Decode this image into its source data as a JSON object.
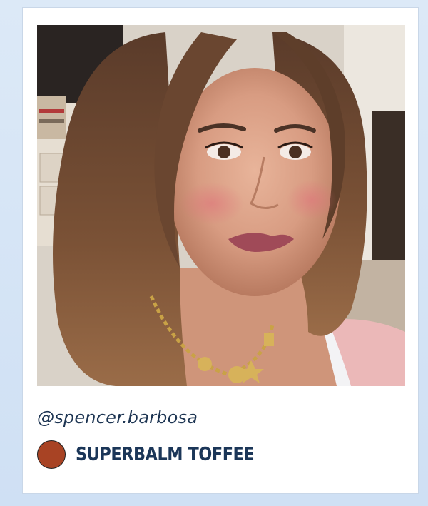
{
  "post": {
    "handle": "@spencer.barbosa",
    "product_name": "SUPERBALM TOFFEE",
    "swatch_color": "#a84324",
    "photo_alt": "selfie photo"
  }
}
